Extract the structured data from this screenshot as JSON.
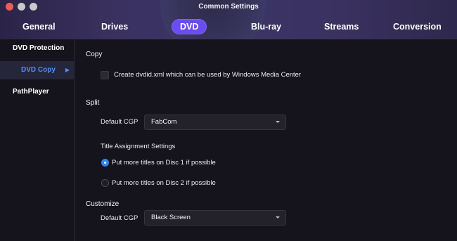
{
  "window": {
    "title": "Common Settings"
  },
  "tabs": [
    {
      "label": "General"
    },
    {
      "label": "Drives"
    },
    {
      "label": "DVD",
      "active": true
    },
    {
      "label": "Blu-ray"
    },
    {
      "label": "Streams"
    },
    {
      "label": "Conversion"
    }
  ],
  "sidebar": {
    "items": [
      {
        "label": "DVD Protection"
      },
      {
        "label": "DVD Copy",
        "active": true
      },
      {
        "label": "PathPlayer"
      }
    ]
  },
  "copy": {
    "heading": "Copy",
    "checkbox_label": "Create dvdid.xml which can be used by Windows Media Center",
    "checked": false
  },
  "split": {
    "heading": "Split",
    "cgp_label": "Default CGP",
    "cgp_value": "FabCom",
    "title_assignment_heading": "Title Assignment Settings",
    "option1": "Put more titles on Disc 1 if possible",
    "option2": "Put more titles on Disc 2 if possible",
    "selected_option": 1
  },
  "customize": {
    "heading": "Customize",
    "cgp_label": "Default CGP",
    "cgp_value": "Black Screen"
  },
  "colors": {
    "accent": "#6a4cf0",
    "sidebar_active_text": "#4f8ff7",
    "radio_selected": "#2e86ee",
    "close_button": "#ee5b58"
  }
}
